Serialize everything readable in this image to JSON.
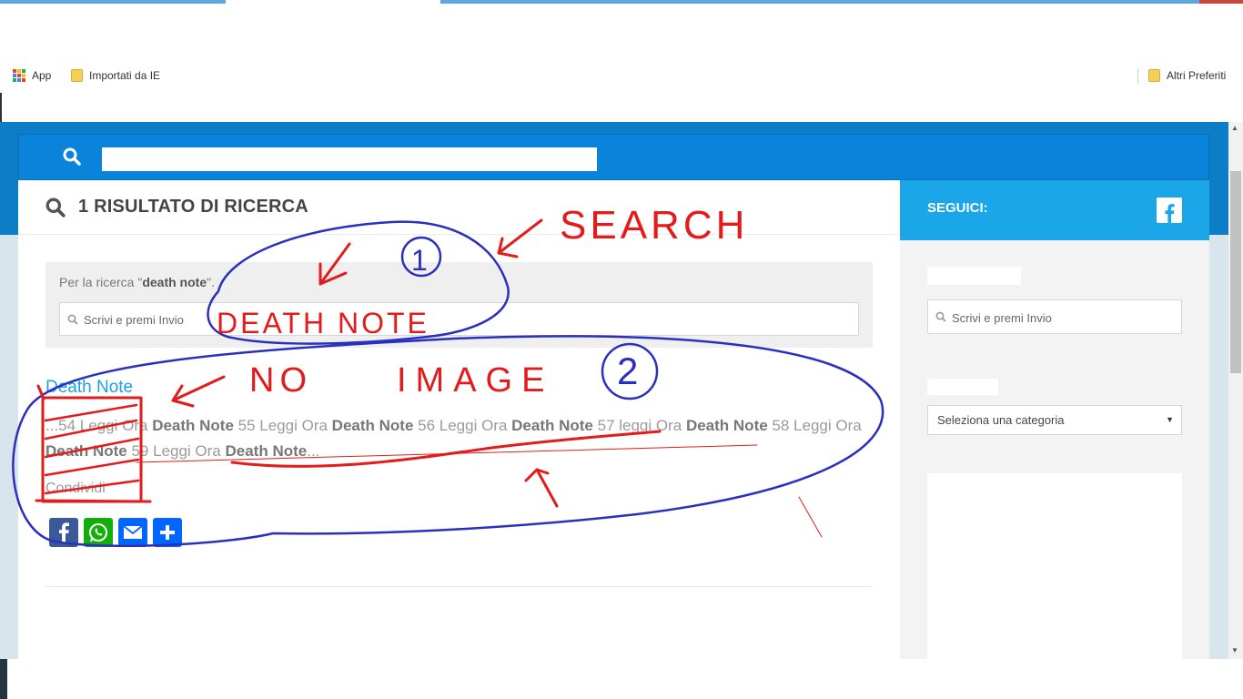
{
  "browser": {
    "bookmarks": [
      {
        "label": "App",
        "icon": "apps-grid-icon"
      },
      {
        "label": "Importati da IE",
        "icon": "folder-icon"
      }
    ],
    "other_bookmarks": "Altri Preferiti"
  },
  "site": {
    "results_title": "1 RISULTATO DI RICERCA",
    "search_label_prefix": "Per la ricerca \"",
    "search_query": "death note",
    "search_label_suffix": "\".",
    "search_placeholder": "Scrivi e premi Invio",
    "post": {
      "title": "Death Note",
      "excerpt": [
        {
          "t": "...54 Leggi Ora ",
          "b": false
        },
        {
          "t": "Death Note",
          "b": true
        },
        {
          "t": " 55 Leggi Ora ",
          "b": false
        },
        {
          "t": "Death Note",
          "b": true
        },
        {
          "t": " 56 Leggi Ora ",
          "b": false
        },
        {
          "t": "Death Note",
          "b": true
        },
        {
          "t": " 57 leggi Ora ",
          "b": false
        },
        {
          "t": "Death Note",
          "b": true
        },
        {
          "t": " 58 Leggi Ora ",
          "b": false
        },
        {
          "t": "Death Note",
          "b": true
        },
        {
          "t": " 59 Leggi Ora ",
          "b": false
        },
        {
          "t": "Death Note",
          "b": true
        },
        {
          "t": "...",
          "b": false
        }
      ],
      "share_label": "Condividi",
      "share_buttons": [
        {
          "name": "facebook",
          "color": "#3b5998"
        },
        {
          "name": "whatsapp",
          "color": "#12af0a"
        },
        {
          "name": "email",
          "color": "#0166ff"
        },
        {
          "name": "share",
          "color": "#0166ff"
        }
      ]
    },
    "sidebar": {
      "follow_label": "SEGUICI:",
      "search_placeholder": "Scrivi e premi Invio",
      "category_select": "Seleziona una categoria"
    }
  },
  "annotations": {
    "color_red": "#e31b1b",
    "color_blue": "#2b2fbf",
    "labels": [
      "SEARCH",
      "DEATH NOTE",
      "NO",
      "IMAGE",
      "1",
      "2"
    ]
  }
}
